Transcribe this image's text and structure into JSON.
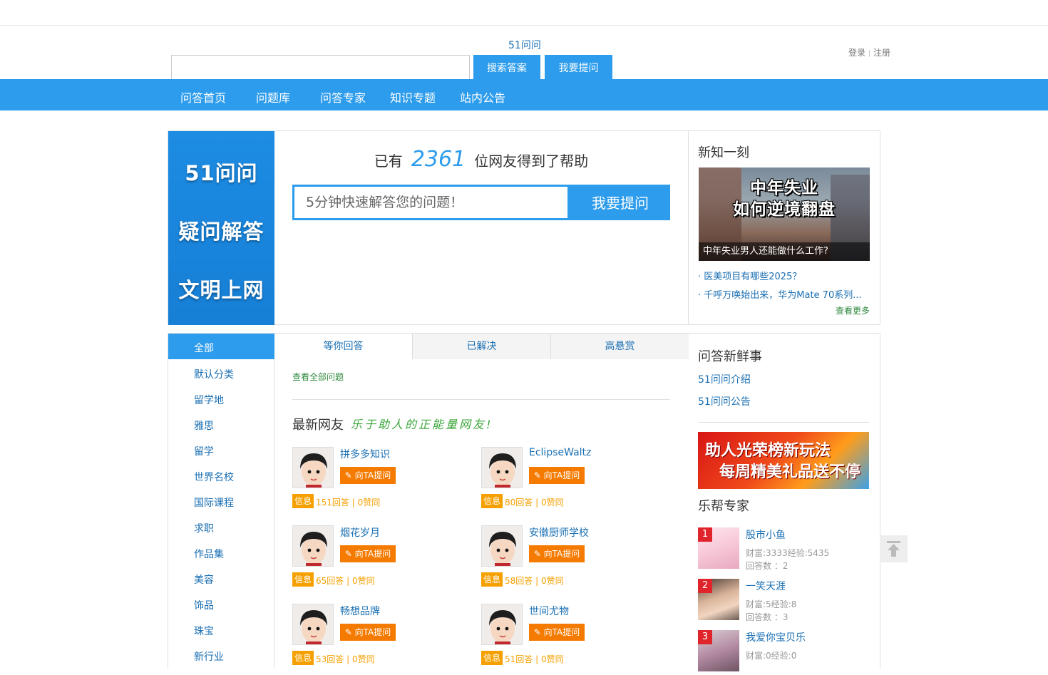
{
  "header": {
    "site_name": "51问问",
    "search_placeholder": "",
    "search_button": "搜索答案",
    "ask_button": "我要提问",
    "login": "登录",
    "register": "注册"
  },
  "nav": [
    "问答首页",
    "问题库",
    "问答专家",
    "知识专题",
    "站内公告"
  ],
  "hero": {
    "banner_lines": [
      "51问问",
      "疑问解答",
      "文明上网"
    ],
    "helped_prefix": "已有",
    "helped_count": "2361",
    "helped_suffix": "位网友得到了帮助",
    "ask_placeholder": "5分钟快速解答您的问题！",
    "ask_button": "我要提问"
  },
  "news": {
    "title": "新知一刻",
    "image_text": "中年失业\n如何逆境翻盘",
    "image_caption": "中年失业男人还能做什么工作?",
    "links": [
      "· 医美项目有哪些2025？",
      "· 千呼万唤始出来，华为Mate 70系列..."
    ],
    "more": "查看更多"
  },
  "categories": {
    "active": "全部",
    "items": [
      "默认分类",
      "留学地",
      "雅思",
      "留学",
      "世界名校",
      "国际课程",
      "求职",
      "作品集",
      "美容",
      "饰品",
      "珠宝",
      "新行业"
    ]
  },
  "tabs": [
    "等你回答",
    "已解决",
    "高悬赏"
  ],
  "all_questions": "查看全部问题",
  "friends": {
    "title": "最新网友",
    "slogan": "乐于助人的正能量网友!",
    "ask_label": "向TA提问",
    "info_label": "信息",
    "users": [
      {
        "name": "拼多多知识",
        "stats": "151回答 | 0赞同"
      },
      {
        "name": "EclipseWaltz",
        "stats": "80回答 | 0赞同"
      },
      {
        "name": "烟花岁月",
        "stats": "65回答 | 0赞同"
      },
      {
        "name": "安徽厨师学校",
        "stats": "58回答 | 0赞同"
      },
      {
        "name": "畅想品牌",
        "stats": "53回答 | 0赞同"
      },
      {
        "name": "世间尤物",
        "stats": "51回答 | 0赞同"
      }
    ]
  },
  "sidebar": {
    "fresh_title": "问答新鲜事",
    "fresh_links": [
      "51问问介绍",
      "51问问公告"
    ],
    "promo_line1": "助人光荣榜新玩法",
    "promo_line2": "每周精美礼品送不停",
    "experts_title": "乐帮专家",
    "experts": [
      {
        "rank": "1",
        "name": "股市小鱼",
        "wealth": "财富:3333经验:5435",
        "answers": "回答数 ：2"
      },
      {
        "rank": "2",
        "name": "一笑天涯",
        "wealth": "财富:5经验:8",
        "answers": "回答数 ：3"
      },
      {
        "rank": "3",
        "name": "我爱你宝贝乐",
        "wealth": "财富:0经验:0",
        "answers": ""
      }
    ]
  },
  "colors": {
    "accent": "#2d9cec",
    "link": "#1a6fb3",
    "orange": "#f57a00",
    "info": "#f5a000",
    "green": "#2f8a3e",
    "rank": "#e0242b"
  }
}
